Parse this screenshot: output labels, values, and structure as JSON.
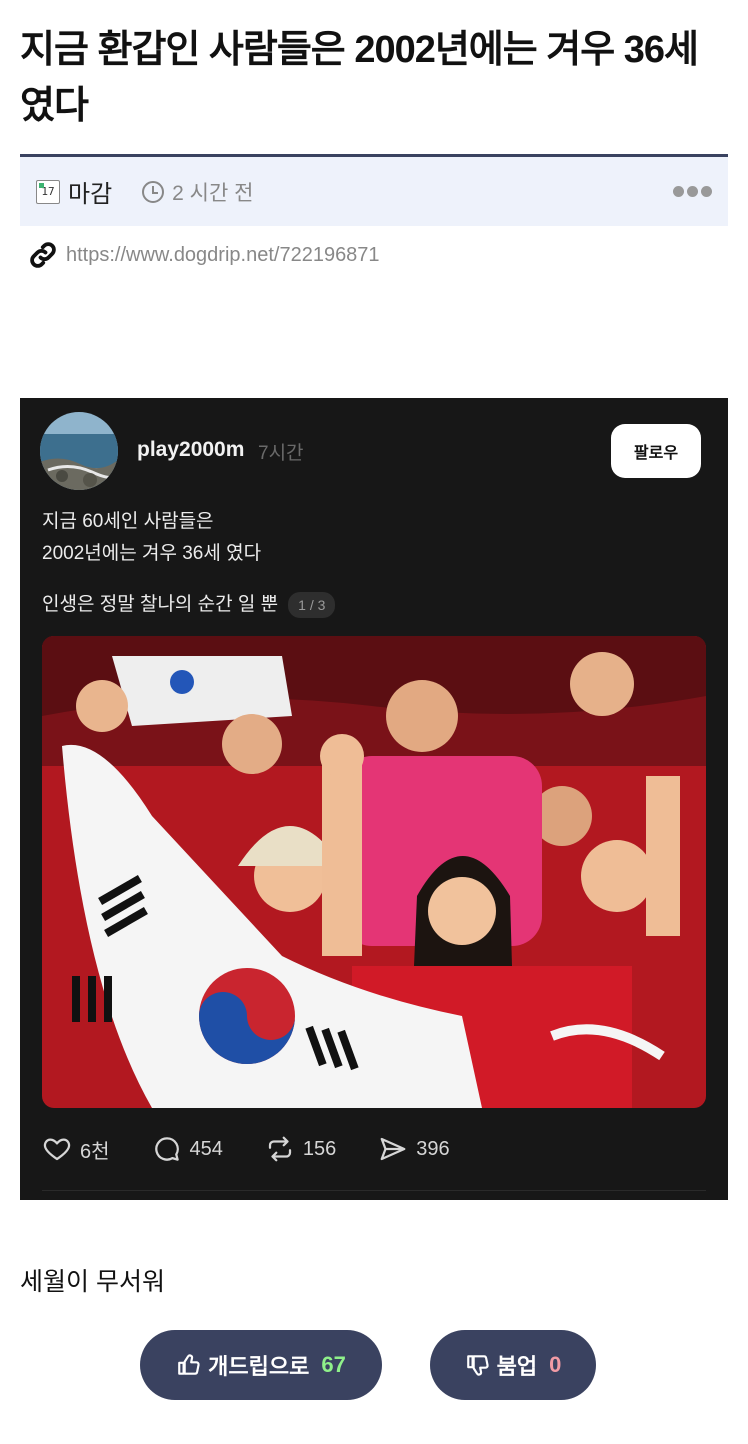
{
  "post": {
    "title": "지금 환갑인 사람들은 2002년에는 겨우 36세 였다",
    "author": "마감",
    "level_badge": "17",
    "time_ago": "2 시간 전",
    "source_url": "https://www.dogdrip.net/722196871",
    "caption": "세월이 무서워"
  },
  "embed": {
    "username": "play2000m",
    "time_ago": "7시간",
    "follow_label": "팔로우",
    "line1": "지금 60세인 사람들은",
    "line2": "2002년에는 겨우 36세 였다",
    "line3": "인생은 정말 찰나의 순간 일 뿐",
    "page_indicator": "1 / 3",
    "likes": "6천",
    "comments": "454",
    "reposts": "156",
    "shares": "396"
  },
  "votes": {
    "up_label": "개드립으로",
    "up_count": "67",
    "down_label": "붐업",
    "down_count": "0"
  },
  "colors": {
    "accent_navy": "#3a4260",
    "meta_bg": "#eef2fb",
    "card_bg": "#171717",
    "up_count": "#8ff08a",
    "down_count": "#f19ba5"
  },
  "icons": [
    "level-badge-icon",
    "clock-icon",
    "more-icon",
    "link-icon",
    "heart-icon",
    "comment-icon",
    "repost-icon",
    "share-icon",
    "thumbs-up-icon",
    "thumbs-down-icon"
  ]
}
